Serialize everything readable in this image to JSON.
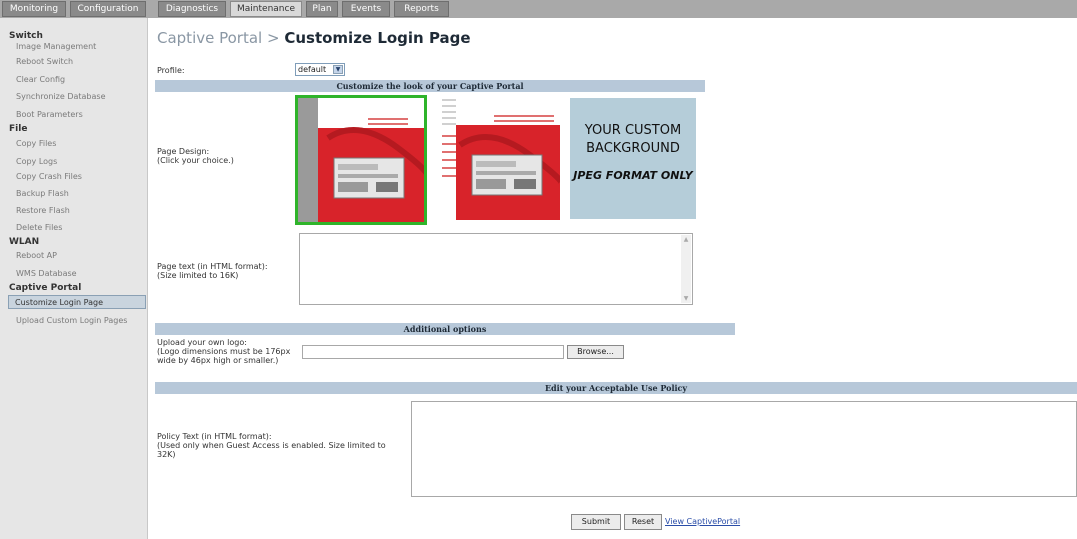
{
  "top_tabs": [
    "Monitoring",
    "Configuration",
    "Diagnostics",
    "Maintenance",
    "Plan",
    "Events",
    "Reports"
  ],
  "active_tab": "Maintenance",
  "sidebar": {
    "items": [
      {
        "type": "head",
        "label": "Switch"
      },
      {
        "type": "link",
        "label": "Image Management"
      },
      {
        "type": "link",
        "label": "Reboot Switch"
      },
      {
        "type": "link",
        "label": "Clear Config"
      },
      {
        "type": "link",
        "label": "Synchronize Database"
      },
      {
        "type": "link",
        "label": "Boot Parameters"
      },
      {
        "type": "head",
        "label": "File"
      },
      {
        "type": "link",
        "label": "Copy Files"
      },
      {
        "type": "link",
        "label": "Copy Logs"
      },
      {
        "type": "link",
        "label": "Copy Crash Files"
      },
      {
        "type": "link",
        "label": "Backup Flash"
      },
      {
        "type": "link",
        "label": "Restore Flash"
      },
      {
        "type": "link",
        "label": "Delete Files"
      },
      {
        "type": "head",
        "label": "WLAN"
      },
      {
        "type": "link",
        "label": "Reboot AP"
      },
      {
        "type": "link",
        "label": "WMS Database"
      },
      {
        "type": "head",
        "label": "Captive Portal"
      },
      {
        "type": "link",
        "label": "Customize Login Page",
        "active": true
      },
      {
        "type": "link",
        "label": "Upload Custom Login Pages"
      }
    ]
  },
  "page": {
    "breadcrumb": "Captive Portal >",
    "title": "Customize Login Page",
    "profile_label": "Profile:",
    "profile_value": "default",
    "customize_header": "Customize the look of your Captive Portal",
    "page_design_label": "Page Design:",
    "page_design_hint": "(Click your choice.)",
    "custom_bg_line1": "YOUR CUSTOM",
    "custom_bg_line2": "BACKGROUND",
    "custom_bg_line3": "JPEG FORMAT ONLY",
    "page_text_label": "Page text (in HTML format):",
    "page_text_hint": "(Size limited to 16K)",
    "page_text_value": "",
    "additional_header": "Additional options",
    "logo_label": "Upload your own logo:",
    "logo_hint_1": "(Logo dimensions must be 176px",
    "logo_hint_2": "wide by 46px high or smaller.)",
    "logo_value": "",
    "browse_label": "Browse...",
    "policy_header": "Edit your Acceptable Use Policy",
    "policy_label": "Policy Text (in HTML format):",
    "policy_hint_1": "(Used only when Guest Access is enabled. Size limited to",
    "policy_hint_2": "32K)",
    "policy_value": "",
    "submit_label": "Submit",
    "reset_label": "Reset",
    "view_link": "View CaptivePortal"
  }
}
